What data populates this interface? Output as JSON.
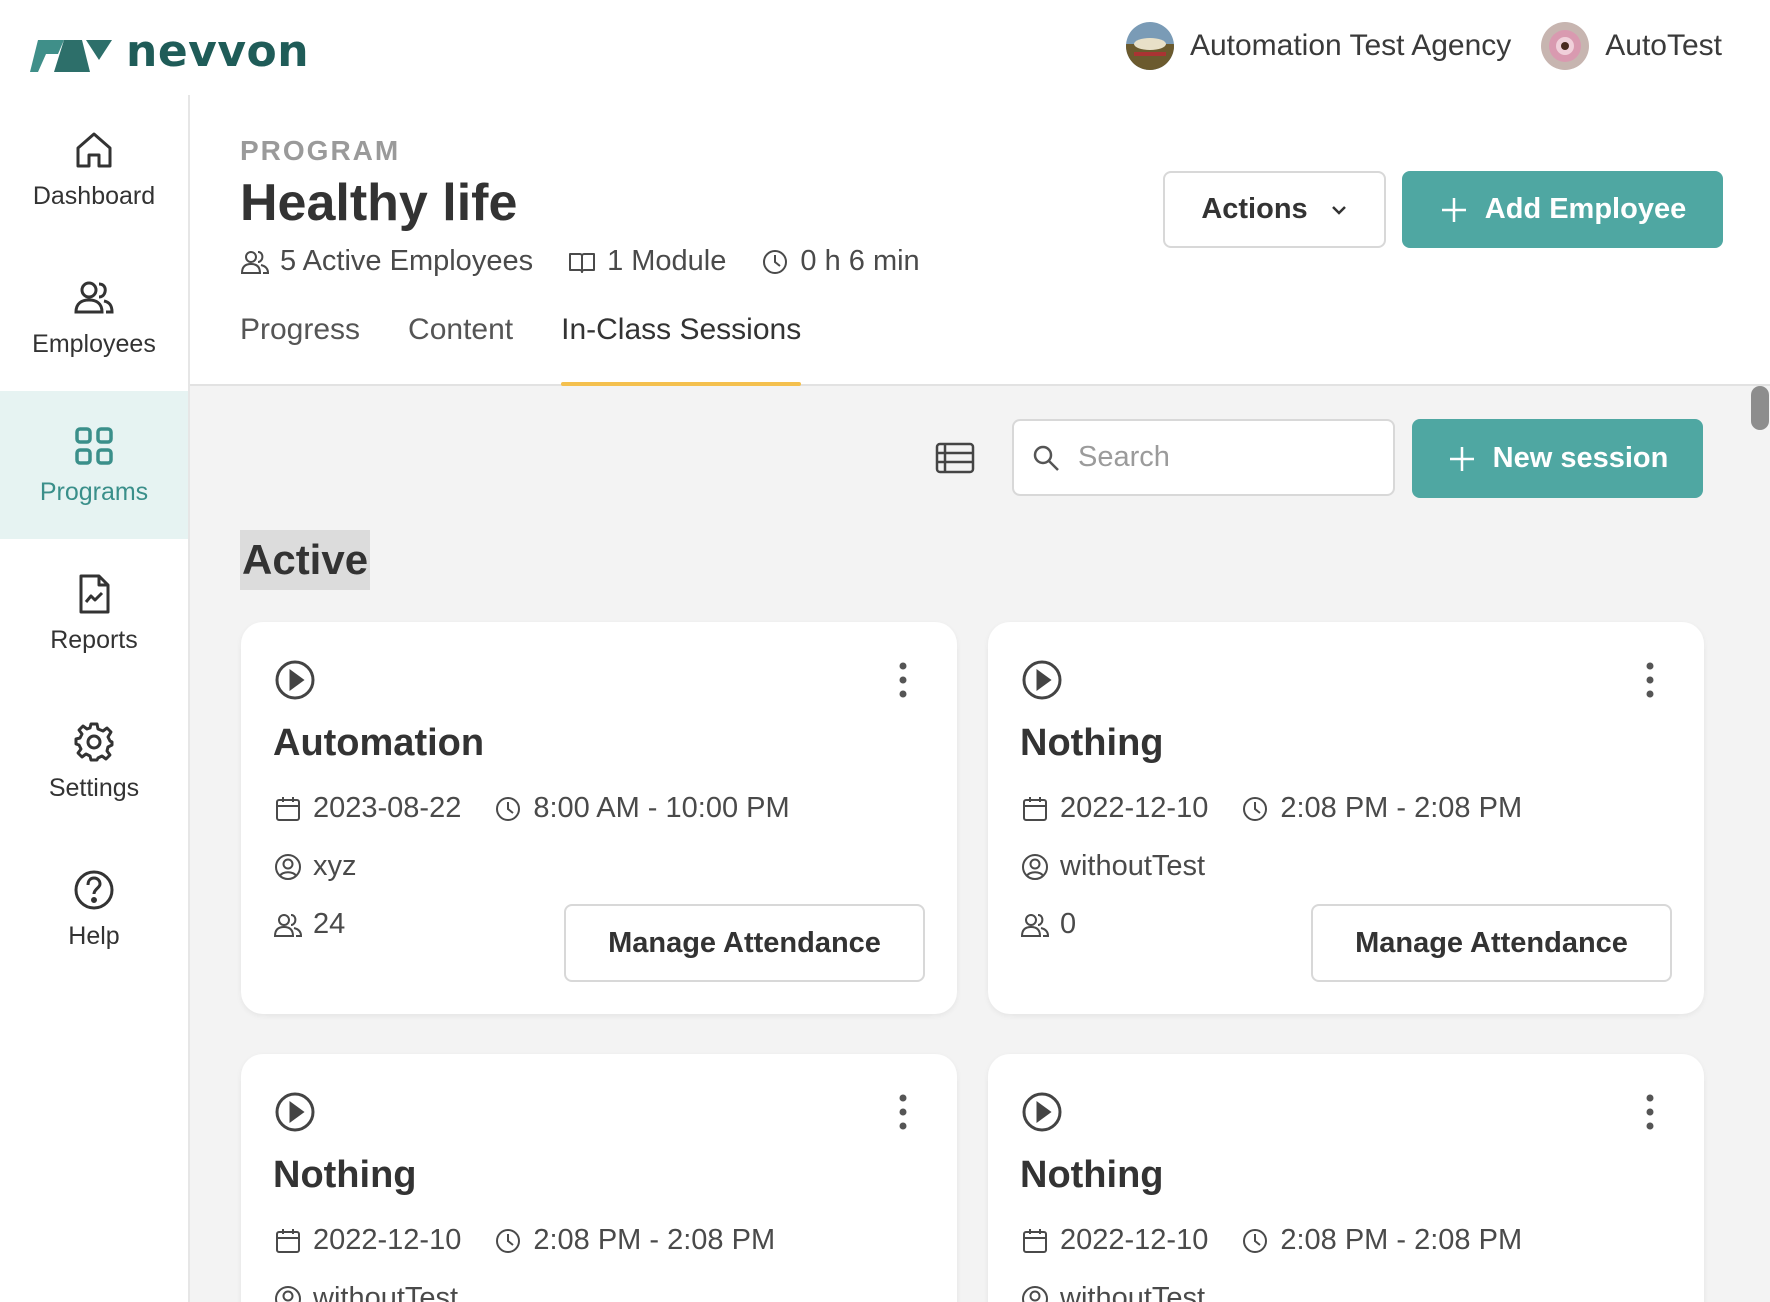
{
  "brand": {
    "name": "nevvon",
    "color": "#1f5c58"
  },
  "top": {
    "agency": "Automation Test Agency",
    "user": "AutoTest"
  },
  "sidebar": {
    "items": [
      {
        "label": "Dashboard",
        "icon": "home-icon"
      },
      {
        "label": "Employees",
        "icon": "users-icon"
      },
      {
        "label": "Programs",
        "icon": "grid-icon",
        "active": true
      },
      {
        "label": "Reports",
        "icon": "report-icon"
      },
      {
        "label": "Settings",
        "icon": "gear-icon"
      },
      {
        "label": "Help",
        "icon": "help-icon"
      }
    ]
  },
  "header": {
    "eyebrow": "PROGRAM",
    "title": "Healthy life",
    "meta": {
      "employees": "5 Active Employees",
      "modules": "1 Module",
      "duration": "0 h 6 min"
    },
    "tabs": [
      "Progress",
      "Content",
      "In-Class Sessions"
    ],
    "active_tab": "In-Class Sessions",
    "actions_label": "Actions",
    "add_employee_label": "Add Employee"
  },
  "toolbar": {
    "search_placeholder": "Search",
    "new_session_label": "New session"
  },
  "section": {
    "title": "Active"
  },
  "sessions": [
    {
      "title": "Automation",
      "date": "2023-08-22",
      "time": "8:00 AM - 10:00 PM",
      "instructor": "xyz",
      "attendees": "24",
      "manage_label": "Manage Attendance"
    },
    {
      "title": "Nothing",
      "date": "2022-12-10",
      "time": "2:08 PM - 2:08 PM",
      "instructor": "withoutTest",
      "attendees": "0",
      "manage_label": "Manage Attendance"
    },
    {
      "title": "Nothing",
      "date": "2022-12-10",
      "time": "2:08 PM - 2:08 PM",
      "instructor": "withoutTest"
    },
    {
      "title": "Nothing",
      "date": "2022-12-10",
      "time": "2:08 PM - 2:08 PM",
      "instructor": "withoutTest"
    }
  ],
  "colors": {
    "primary": "#4fa7a2",
    "tab_underline": "#f4c04e",
    "active_nav_bg": "#e6f3f2"
  }
}
